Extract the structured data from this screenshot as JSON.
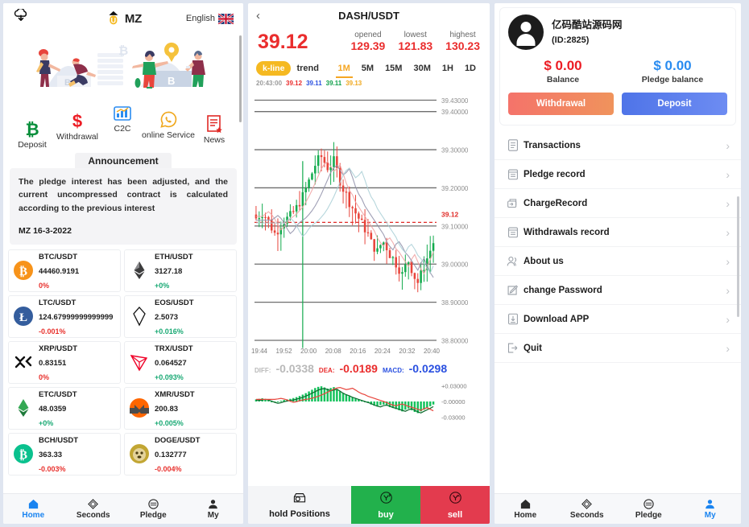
{
  "home": {
    "header": {
      "download_icon": "cloud-download-icon",
      "brand": "MZ",
      "language": "English",
      "flag": "uk-flag-icon"
    },
    "quick_actions": [
      {
        "label": "Deposit",
        "icon": "bitcoin-icon"
      },
      {
        "label": "Withdrawal",
        "icon": "dollar-icon"
      },
      {
        "label": "C2C",
        "icon": "bar-chart-icon"
      },
      {
        "label": "online Service",
        "icon": "whatsapp-icon"
      },
      {
        "label": "News",
        "icon": "news-document-icon"
      }
    ],
    "announcement": {
      "tab_label": "Announcement",
      "body": "The pledge interest has been adjusted, and the current uncompressed contract is calculated according to the previous interest",
      "date": "MZ 16-3-2022"
    },
    "coins": [
      {
        "pair": "BTC/USDT",
        "price": "44460.9191",
        "change": "0%",
        "dir": "down",
        "icon": "btc-icon"
      },
      {
        "pair": "ETH/USDT",
        "price": "3127.18",
        "change": "+0%",
        "dir": "up",
        "icon": "eth-icon"
      },
      {
        "pair": "LTC/USDT",
        "price": "124.67999999999999",
        "change": "-0.001%",
        "dir": "down",
        "icon": "ltc-icon"
      },
      {
        "pair": "EOS/USDT",
        "price": "2.5073",
        "change": "+0.016%",
        "dir": "up",
        "icon": "eos-icon"
      },
      {
        "pair": "XRP/USDT",
        "price": "0.83151",
        "change": "0%",
        "dir": "down",
        "icon": "xrp-icon"
      },
      {
        "pair": "TRX/USDT",
        "price": "0.064527",
        "change": "+0.093%",
        "dir": "up",
        "icon": "trx-icon"
      },
      {
        "pair": "ETC/USDT",
        "price": "48.0359",
        "change": "+0%",
        "dir": "up",
        "icon": "etc-icon"
      },
      {
        "pair": "XMR/USDT",
        "price": "200.83",
        "change": "+0.005%",
        "dir": "up",
        "icon": "xmr-icon"
      },
      {
        "pair": "BCH/USDT",
        "price": "363.33",
        "change": "-0.003%",
        "dir": "down",
        "icon": "bch-icon"
      },
      {
        "pair": "DOGE/USDT",
        "price": "0.132777",
        "change": "-0.004%",
        "dir": "down",
        "icon": "doge-icon"
      }
    ],
    "tabbar": [
      {
        "label": "Home",
        "icon": "home-icon",
        "active": true
      },
      {
        "label": "Seconds",
        "icon": "seconds-icon",
        "active": false
      },
      {
        "label": "Pledge",
        "icon": "pledge-icon",
        "active": false
      },
      {
        "label": "My",
        "icon": "user-icon",
        "active": false
      }
    ]
  },
  "trade": {
    "back_icon": "chevron-left-icon",
    "title": "DASH/USDT",
    "last_price": "39.12",
    "stats": [
      {
        "key": "opened",
        "value": "129.39"
      },
      {
        "key": "lowest",
        "value": "121.83"
      },
      {
        "key": "highest",
        "value": "130.23"
      }
    ],
    "chart_modes": [
      {
        "label": "k-line",
        "style": "pill"
      },
      {
        "label": "trend",
        "style": "plain"
      }
    ],
    "timeframes": [
      {
        "label": "1M",
        "active": true
      },
      {
        "label": "5M",
        "active": false
      },
      {
        "label": "15M",
        "active": false
      },
      {
        "label": "30M",
        "active": false
      },
      {
        "label": "1H",
        "active": false
      },
      {
        "label": "1D",
        "active": false
      }
    ],
    "ohlc": {
      "time": "20:43:00",
      "open": "39.12",
      "high": "39.11",
      "low": "39.11",
      "close": "39.13"
    },
    "macd_readout": [
      {
        "label": "DIFF:",
        "value": "-0.0338",
        "color": "#b9b9b9"
      },
      {
        "label": "DEA:",
        "value": "-0.0189",
        "color": "#ea2d2d"
      },
      {
        "label": "MACD:",
        "value": "-0.0298",
        "color": "#2a50e0"
      }
    ],
    "current_price_tag": "39.12",
    "actions": [
      {
        "label": "hold Positions",
        "icon": "positions-icon",
        "kind": "hold"
      },
      {
        "label": "buy",
        "icon": "buy-icon",
        "kind": "buy"
      },
      {
        "label": "sell",
        "icon": "sell-icon",
        "kind": "sell"
      }
    ],
    "chart_data": {
      "type": "line",
      "title": "DASH/USDT 1M candlestick",
      "xlabel": "",
      "ylabel": "",
      "grid": true,
      "y_ticks": [
        "39.43000",
        "39.40000",
        "39.30000",
        "39.20000",
        "39.10000",
        "39.00000",
        "38.90000",
        "38.80000"
      ],
      "ylim": [
        38.8,
        39.45
      ],
      "x_ticks": [
        "19:44",
        "19:52",
        "20:00",
        "20:08",
        "20:16",
        "20:24",
        "20:32",
        "20:40"
      ],
      "price_marker": 39.12,
      "macd_panel": {
        "type": "bar",
        "y_ticks": [
          "+0.03000",
          "-0.00000",
          "-0.03000"
        ],
        "ylim": [
          -0.03,
          0.03
        ],
        "series": [
          {
            "name": "DIFF",
            "value": -0.0338
          },
          {
            "name": "DEA",
            "value": -0.0189
          },
          {
            "name": "MACD",
            "value": -0.0298
          }
        ]
      }
    }
  },
  "account": {
    "avatar_icon": "avatar-icon",
    "name": "亿码酷站源码网",
    "id": "(ID:2825)",
    "balances": [
      {
        "amount": "$ 0.00",
        "caption": "Balance",
        "color": "#ec1c24"
      },
      {
        "amount": "$ 0.00",
        "caption": "Pledge balance",
        "color": "#2a8cf0"
      }
    ],
    "buttons": [
      {
        "label": "Withdrawal",
        "kind": "w"
      },
      {
        "label": "Deposit",
        "kind": "d"
      }
    ],
    "menu": [
      {
        "label": "Transactions",
        "icon": "list-document-icon"
      },
      {
        "label": "Pledge record",
        "icon": "record-icon"
      },
      {
        "label": "ChargeRecord",
        "icon": "charge-icon"
      },
      {
        "label": "Withdrawals record",
        "icon": "withdraw-record-icon"
      },
      {
        "label": "About us",
        "icon": "people-icon"
      },
      {
        "label": "change Password",
        "icon": "edit-icon"
      },
      {
        "label": "Download APP",
        "icon": "download-icon"
      },
      {
        "label": "Quit",
        "icon": "logout-icon"
      }
    ],
    "tabbar": [
      {
        "label": "Home",
        "icon": "home-icon",
        "active": false
      },
      {
        "label": "Seconds",
        "icon": "seconds-icon",
        "active": false
      },
      {
        "label": "Pledge",
        "icon": "pledge-icon",
        "active": false
      },
      {
        "label": "My",
        "icon": "user-icon",
        "active": true
      }
    ]
  }
}
